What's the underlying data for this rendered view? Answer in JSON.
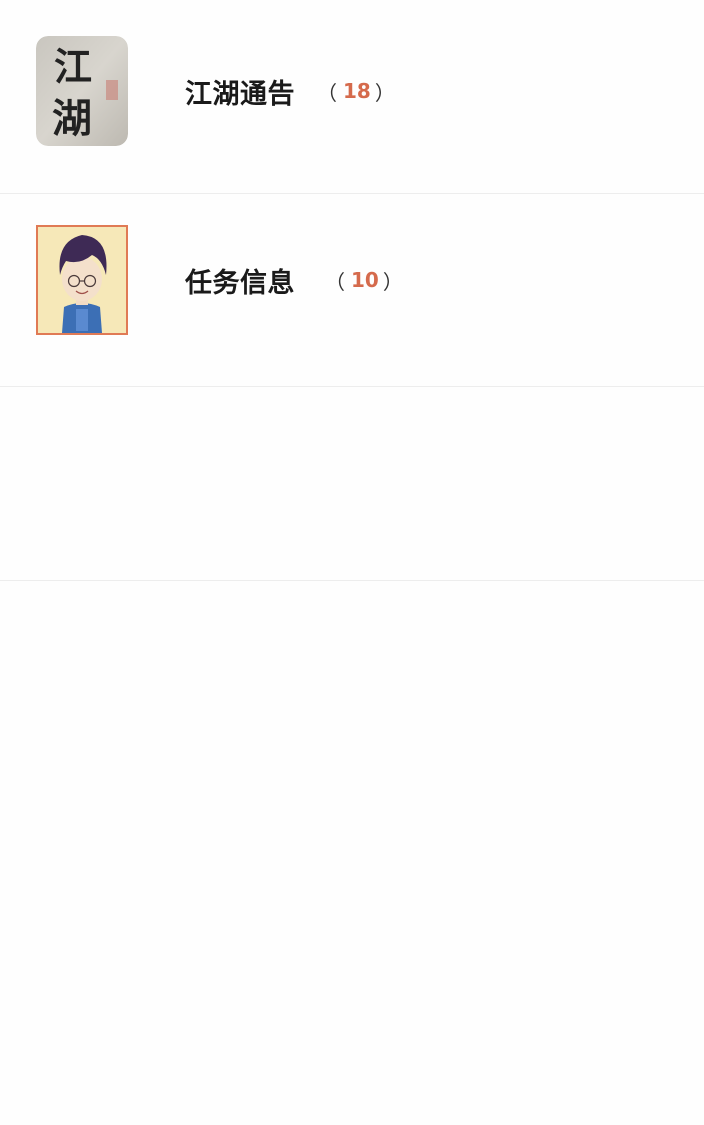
{
  "items": [
    {
      "title": "江湖通告",
      "count_open": "（",
      "count": "18",
      "count_close": "）",
      "avatar_text_1": "江",
      "avatar_text_2": "湖",
      "avatar_icon": "calligraphy-logo"
    },
    {
      "title": "任务信息",
      "count_open": "（",
      "count": "10",
      "count_close": "）",
      "avatar_icon": "cartoon-boy-avatar"
    }
  ],
  "colors": {
    "count": "#d56a4c",
    "divider": "#ededed",
    "title": "#1a1a1a"
  }
}
